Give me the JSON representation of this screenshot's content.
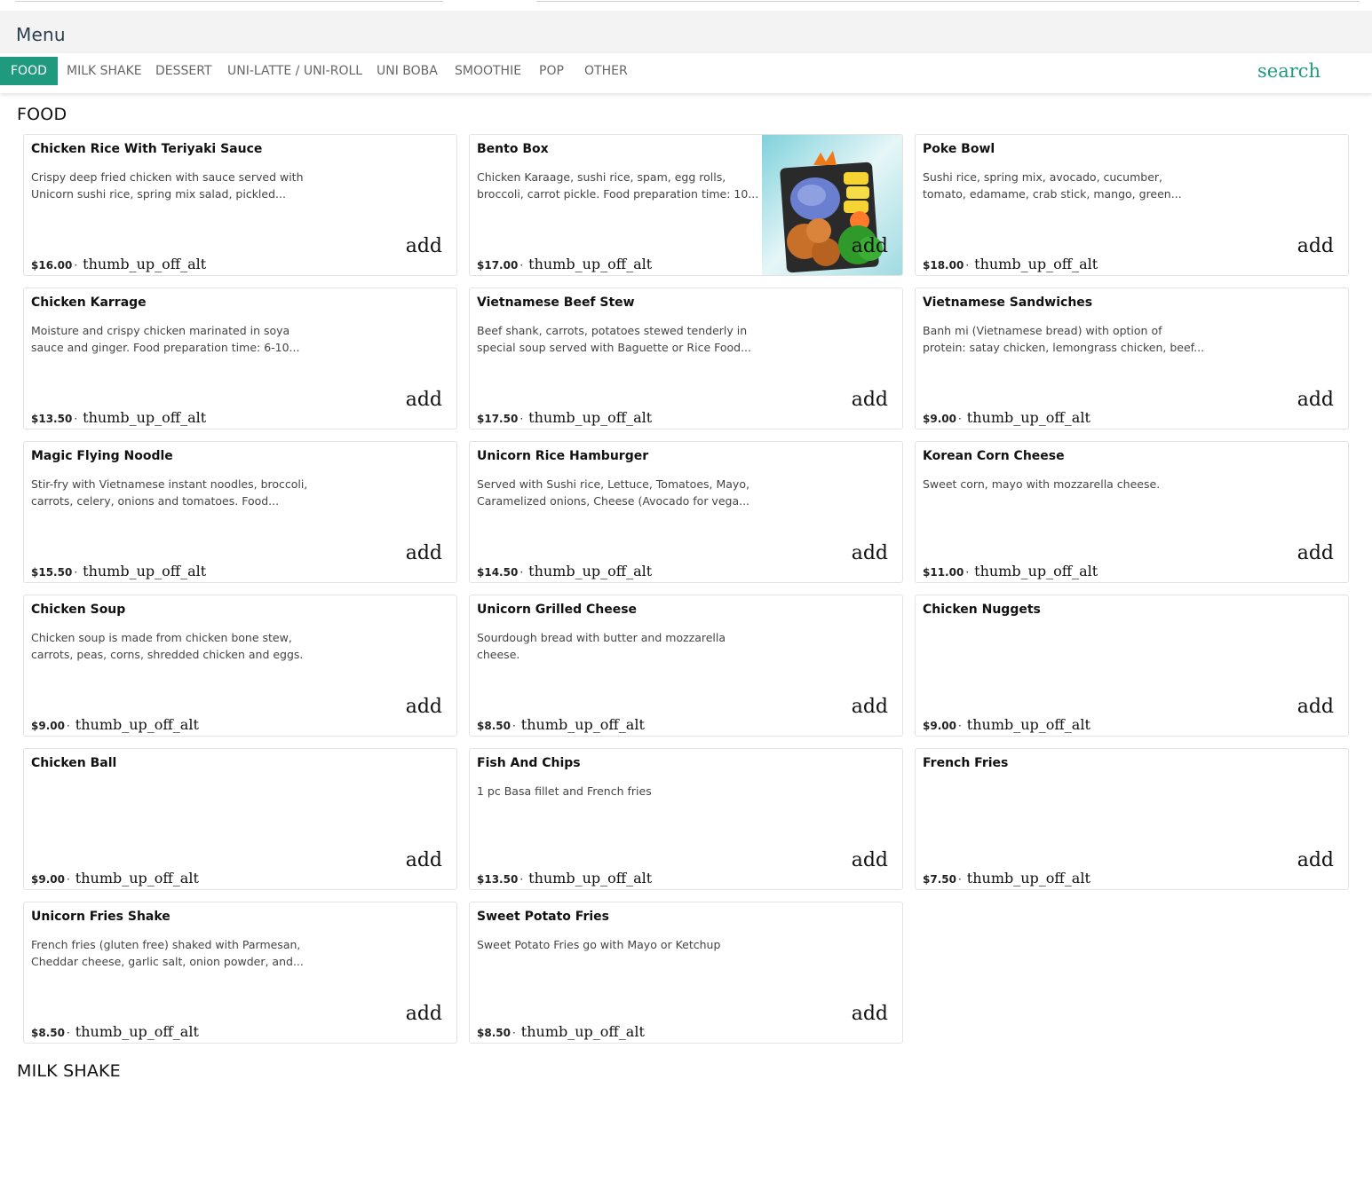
{
  "header": {
    "title": "Menu"
  },
  "tabs": [
    {
      "label": "FOOD",
      "active": true
    },
    {
      "label": "MILK SHAKE"
    },
    {
      "label": "DESSERT"
    },
    {
      "label": "UNI-LATTE / UNI-ROLL"
    },
    {
      "label": "UNI BOBA"
    },
    {
      "label": "SMOOTHIE"
    },
    {
      "label": "POP"
    },
    {
      "label": "OTHER"
    }
  ],
  "search_label": "search",
  "sections": {
    "food": "FOOD",
    "milk_shake": "MILK SHAKE"
  },
  "colors": {
    "accent": "#1f9a7e",
    "menu_bar_bg": "#f3f3f3"
  },
  "items": [
    {
      "name": "Chicken Rice With Teriyaki Sauce",
      "desc": "Crispy deep fried chicken with sauce served with Unicorn sushi rice, spring mix salad, pickled...",
      "price": "$16.00",
      "sep": "·",
      "icon": "thumb_up_off_alt",
      "action": "add"
    },
    {
      "name": "Bento Box",
      "desc": "Chicken Karaage, sushi rice, spam, egg rolls, broccoli, carrot pickle. Food preparation time: 10...",
      "price": "$17.00",
      "sep": "·",
      "icon": "thumb_up_off_alt",
      "action": "add",
      "has_photo": true
    },
    {
      "name": "Poke Bowl",
      "desc": "Sushi rice, spring mix, avocado, cucumber, tomato, edamame, crab stick, mango, green...",
      "price": "$18.00",
      "sep": "·",
      "icon": "thumb_up_off_alt",
      "action": "add"
    },
    {
      "name": "Chicken Karrage",
      "desc": "Moisture and crispy chicken marinated in soya sauce and ginger. Food preparation time: 6-10...",
      "price": "$13.50",
      "sep": "·",
      "icon": "thumb_up_off_alt",
      "action": "add"
    },
    {
      "name": "Vietnamese Beef Stew",
      "desc": "Beef shank, carrots, potatoes stewed tenderly in special soup served with Baguette or Rice Food...",
      "price": "$17.50",
      "sep": "·",
      "icon": "thumb_up_off_alt",
      "action": "add"
    },
    {
      "name": "Vietnamese Sandwiches",
      "desc": "Banh mi (Vietnamese bread) with option of protein: satay chicken, lemongrass chicken, beef...",
      "price": "$9.00",
      "sep": "·",
      "icon": "thumb_up_off_alt",
      "action": "add"
    },
    {
      "name": "Magic Flying Noodle",
      "desc": "Stir-fry with Vietnamese instant noodles, broccoli, carrots, celery, onions and tomatoes. Food...",
      "price": "$15.50",
      "sep": "·",
      "icon": "thumb_up_off_alt",
      "action": "add"
    },
    {
      "name": "Unicorn Rice Hamburger",
      "desc": "Served with Sushi rice, Lettuce, Tomatoes, Mayo, Caramelized onions, Cheese (Avocado for vega...",
      "price": "$14.50",
      "sep": "·",
      "icon": "thumb_up_off_alt",
      "action": "add"
    },
    {
      "name": "Korean Corn Cheese",
      "desc": "Sweet corn, mayo with mozzarella cheese.",
      "price": "$11.00",
      "sep": "·",
      "icon": "thumb_up_off_alt",
      "action": "add"
    },
    {
      "name": "Chicken Soup",
      "desc": "Chicken soup is made from chicken bone stew, carrots, peas, corns, shredded chicken and eggs.",
      "price": "$9.00",
      "sep": "·",
      "icon": "thumb_up_off_alt",
      "action": "add"
    },
    {
      "name": "Unicorn Grilled Cheese",
      "desc": "Sourdough bread with butter and mozzarella cheese.",
      "price": "$8.50",
      "sep": "·",
      "icon": "thumb_up_off_alt",
      "action": "add"
    },
    {
      "name": "Chicken Nuggets",
      "desc": "",
      "price": "$9.00",
      "sep": "·",
      "icon": "thumb_up_off_alt",
      "action": "add"
    },
    {
      "name": "Chicken Ball",
      "desc": "",
      "price": "$9.00",
      "sep": "·",
      "icon": "thumb_up_off_alt",
      "action": "add"
    },
    {
      "name": "Fish And Chips",
      "desc": "1 pc Basa fillet and French fries",
      "price": "$13.50",
      "sep": "·",
      "icon": "thumb_up_off_alt",
      "action": "add"
    },
    {
      "name": "French Fries",
      "desc": "",
      "price": "$7.50",
      "sep": "·",
      "icon": "thumb_up_off_alt",
      "action": "add"
    },
    {
      "name": "Unicorn Fries Shake",
      "desc": "French fries (gluten free) shaked with Parmesan, Cheddar cheese, garlic salt, onion powder, and...",
      "price": "$8.50",
      "sep": "·",
      "icon": "thumb_up_off_alt",
      "action": "add"
    },
    {
      "name": "Sweet Potato Fries",
      "desc": "Sweet Potato Fries go with Mayo or Ketchup",
      "price": "$8.50",
      "sep": "·",
      "icon": "thumb_up_off_alt",
      "action": "add"
    }
  ]
}
